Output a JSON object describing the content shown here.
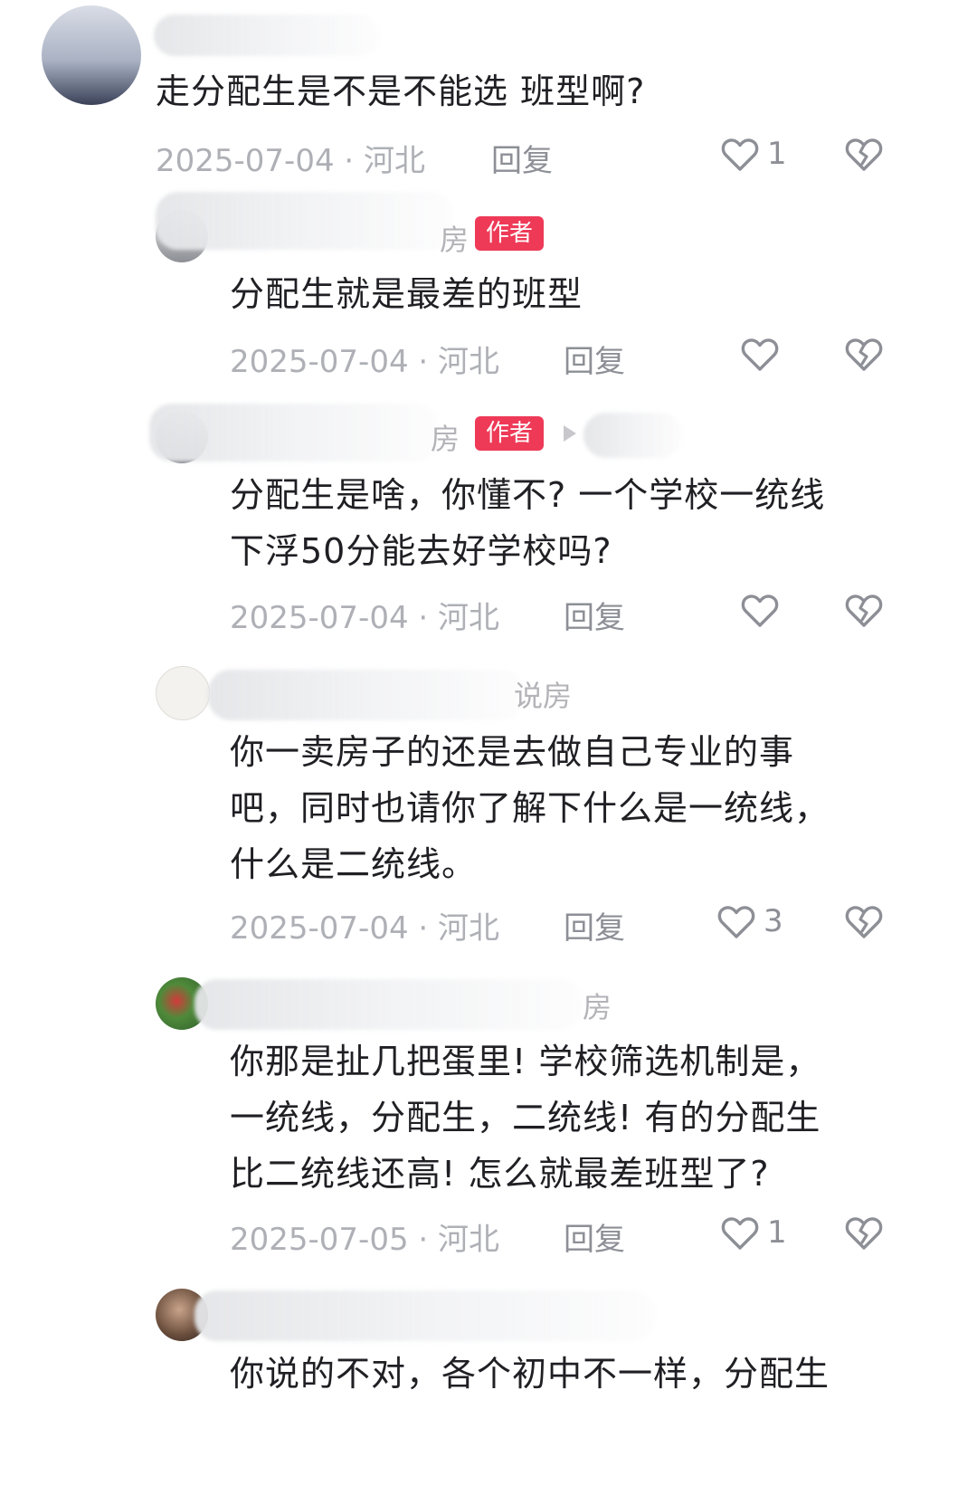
{
  "badge_label": "作者",
  "colors": {
    "badge": "#ee3a57",
    "meta": "#aeb0b6",
    "text": "#1f1f24"
  },
  "icons": {
    "like": "heart-icon",
    "dislike": "broken-heart-icon"
  },
  "comments": [
    {
      "name_tail": "",
      "text": "走分配生是不是不能选 班型啊?",
      "date": "2025-07-04",
      "region": "河北",
      "reply_label": "回复",
      "likes": "1",
      "author": false
    },
    {
      "name_tail": "房",
      "text": "分配生就是最差的班型",
      "date": "2025-07-04",
      "region": "河北",
      "reply_label": "回复",
      "likes": "",
      "author": true
    },
    {
      "name_tail": "房",
      "text": "分配生是啥，你懂不? 一个学校一统线\n下浮50分能去好学校吗?",
      "date": "2025-07-04",
      "region": "河北",
      "reply_label": "回复",
      "likes": "",
      "author": true
    },
    {
      "name_tail": "说房",
      "text": "你一卖房子的还是去做自己专业的事\n吧，同时也请你了解下什么是一统线，\n什么是二统线。",
      "date": "2025-07-04",
      "region": "河北",
      "reply_label": "回复",
      "likes": "3",
      "author": false
    },
    {
      "name_tail": "房",
      "text": "你那是扯几把蛋里! 学校筛选机制是，\n一统线，分配生，二统线! 有的分配生\n比二统线还高! 怎么就最差班型了?",
      "date": "2025-07-05",
      "region": "河北",
      "reply_label": "回复",
      "likes": "1",
      "author": false
    },
    {
      "name_tail": "",
      "text": "你说的不对，各个初中不一样，分配生",
      "date": "",
      "region": "",
      "reply_label": "",
      "likes": "",
      "author": false
    }
  ]
}
